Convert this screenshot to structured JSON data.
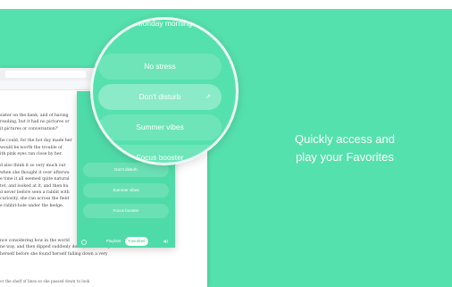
{
  "background_color": "#55e1ad",
  "headline": {
    "line1": "Quickly access and",
    "line2": "play your Favorites"
  },
  "document": {
    "lines_top": [
      "sister on the bank, and of having",
      "reading, but it had no pictures or",
      "it pictures or conversation?'",
      "",
      "he could, for the hot day made her",
      "would be worth the trouble of",
      "ith pink eyes ran close by her.",
      "",
      "d also think it so very much out",
      "when she thought it over afterwa",
      "e time it all seemed quite natural",
      "tet, and looked at it, and then hu",
      "d never before seen a rabbit with",
      "curiosity, she ran across the field",
      "e rabbit-hole under the hedge."
    ],
    "lines_bottom": [
      "nce considering how in the world",
      "",
      "ne way, and then dipped suddenly down, so suddenly",
      "herself before she found herself falling down a very"
    ],
    "footer": "or the shelf of lines so she passed down to look"
  },
  "popup": {
    "items": [
      "Don't disturb",
      "Summer vibes",
      "Focus booster"
    ],
    "tabs": {
      "playlists": "Playlists",
      "favorites": "Favorites"
    }
  },
  "magnifier": {
    "top_item": "Monday morning",
    "items": [
      "No stress",
      "Don't disturb",
      "Summer vibes",
      "Focus booster"
    ],
    "active_arrow": "⇗"
  }
}
